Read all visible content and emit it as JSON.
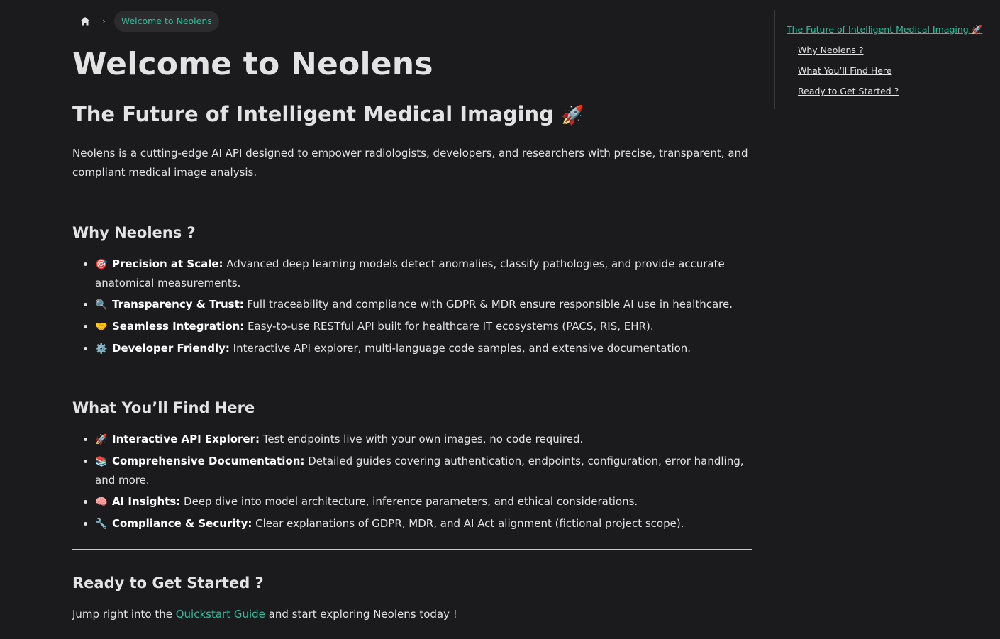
{
  "breadcrumb": {
    "home_icon": "home-icon",
    "separator": "›",
    "current": "Welcome to Neolens"
  },
  "page": {
    "title": "Welcome to Neolens",
    "subtitle": "The Future of Intelligent Medical Imaging",
    "subtitle_emoji": "🚀",
    "intro": "Neolens is a cutting-edge AI API designed to empower radiologists, developers, and researchers with precise, transparent, and compliant medical image analysis."
  },
  "why": {
    "heading": "Why Neolens ?",
    "items": [
      {
        "emoji": "🎯",
        "label": "Precision at Scale:",
        "text": " Advanced deep learning models detect anomalies, classify pathologies, and provide accurate anatomical measurements."
      },
      {
        "emoji": "🔍",
        "label": "Transparency & Trust:",
        "text": " Full traceability and compliance with GDPR & MDR ensure responsible AI use in healthcare."
      },
      {
        "emoji": "🤝",
        "label": "Seamless Integration:",
        "text": " Easy-to-use RESTful API built for healthcare IT ecosystems (PACS, RIS, EHR)."
      },
      {
        "emoji": "⚙️",
        "label": "Developer Friendly:",
        "text": " Interactive API explorer, multi-language code samples, and extensive documentation."
      }
    ]
  },
  "find": {
    "heading": "What You’ll Find Here",
    "items": [
      {
        "emoji": "🚀",
        "label": "Interactive API Explorer:",
        "text": " Test endpoints live with your own images, no code required."
      },
      {
        "emoji": "📚",
        "label": "Comprehensive Documentation:",
        "text": " Detailed guides covering authentication, endpoints, configuration, error handling, and more."
      },
      {
        "emoji": "🧠",
        "label": "AI Insights:",
        "text": " Deep dive into model architecture, inference parameters, and ethical considerations."
      },
      {
        "emoji": "🔧",
        "label": "Compliance & Security:",
        "text": " Clear explanations of GDPR, MDR, and AI Act alignment (fictional project scope)."
      }
    ]
  },
  "ready": {
    "heading": "Ready to Get Started ?",
    "text_before": "Jump right into the ",
    "link": "Quickstart Guide",
    "text_after": " and start exploring Neolens today !"
  },
  "toc": {
    "active": "The Future of Intelligent Medical Imaging 🚀",
    "items": [
      "Why Neolens ?",
      "What You’ll Find Here",
      "Ready to Get Started ?"
    ]
  },
  "colors": {
    "background": "#1b1b1d",
    "accent": "#25c2a0",
    "text": "#e3e3e3"
  }
}
